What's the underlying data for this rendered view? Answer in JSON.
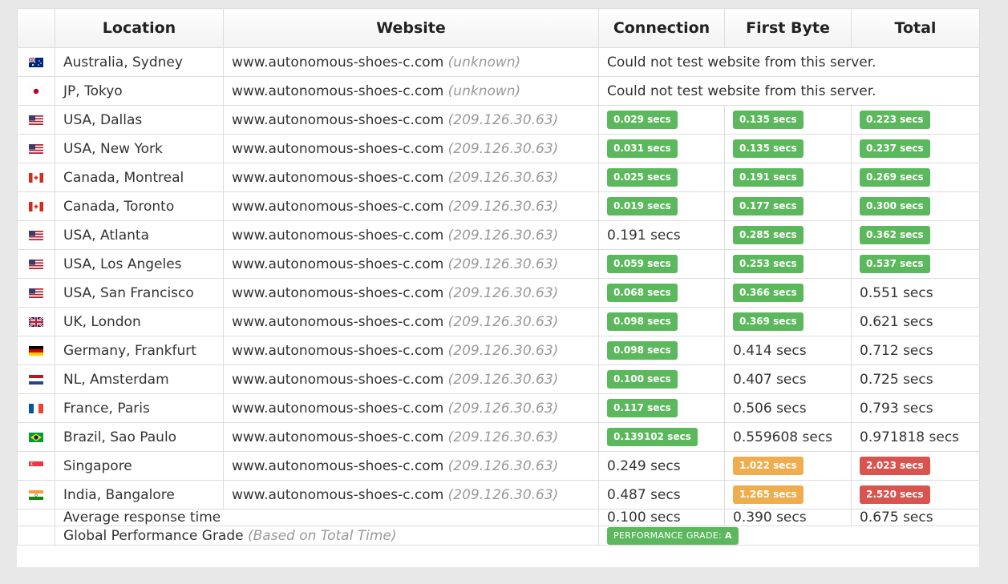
{
  "headers": {
    "flag": "",
    "location": "Location",
    "website": "Website",
    "connection": "Connection",
    "first_byte": "First Byte",
    "total": "Total"
  },
  "rows": [
    {
      "flag": "au-flag-icon",
      "location": "Australia, Sydney",
      "url": "www.autonomous-shoes-c.com",
      "ip": "(unknown)",
      "message": "Could not test website from this server."
    },
    {
      "flag": "jp-flag-icon",
      "location": "JP, Tokyo",
      "url": "www.autonomous-shoes-c.com",
      "ip": "(unknown)",
      "message": "Could not test website from this server."
    },
    {
      "flag": "us-flag-icon",
      "location": "USA, Dallas",
      "url": "www.autonomous-shoes-c.com",
      "ip": "(209.126.30.63)",
      "connection": "0.029 secs",
      "connection_status": "green",
      "first_byte": "0.135 secs",
      "first_byte_status": "green",
      "total": "0.223 secs",
      "total_status": "green"
    },
    {
      "flag": "us-flag-icon",
      "location": "USA, New York",
      "url": "www.autonomous-shoes-c.com",
      "ip": "(209.126.30.63)",
      "connection": "0.031 secs",
      "connection_status": "green",
      "first_byte": "0.135 secs",
      "first_byte_status": "green",
      "total": "0.237 secs",
      "total_status": "green"
    },
    {
      "flag": "ca-flag-icon",
      "location": "Canada, Montreal",
      "url": "www.autonomous-shoes-c.com",
      "ip": "(209.126.30.63)",
      "connection": "0.025 secs",
      "connection_status": "green",
      "first_byte": "0.191 secs",
      "first_byte_status": "green",
      "total": "0.269 secs",
      "total_status": "green"
    },
    {
      "flag": "ca-flag-icon",
      "location": "Canada, Toronto",
      "url": "www.autonomous-shoes-c.com",
      "ip": "(209.126.30.63)",
      "connection": "0.019 secs",
      "connection_status": "green",
      "first_byte": "0.177 secs",
      "first_byte_status": "green",
      "total": "0.300 secs",
      "total_status": "green"
    },
    {
      "flag": "us-flag-icon",
      "location": "USA, Atlanta",
      "url": "www.autonomous-shoes-c.com",
      "ip": "(209.126.30.63)",
      "connection": "0.191 secs",
      "connection_status": "plain",
      "first_byte": "0.285 secs",
      "first_byte_status": "green",
      "total": "0.362 secs",
      "total_status": "green"
    },
    {
      "flag": "us-flag-icon",
      "location": "USA, Los Angeles",
      "url": "www.autonomous-shoes-c.com",
      "ip": "(209.126.30.63)",
      "connection": "0.059 secs",
      "connection_status": "green",
      "first_byte": "0.253 secs",
      "first_byte_status": "green",
      "total": "0.537 secs",
      "total_status": "green"
    },
    {
      "flag": "us-flag-icon",
      "location": "USA, San Francisco",
      "url": "www.autonomous-shoes-c.com",
      "ip": "(209.126.30.63)",
      "connection": "0.068 secs",
      "connection_status": "green",
      "first_byte": "0.366 secs",
      "first_byte_status": "green",
      "total": "0.551 secs",
      "total_status": "plain"
    },
    {
      "flag": "uk-flag-icon",
      "location": "UK, London",
      "url": "www.autonomous-shoes-c.com",
      "ip": "(209.126.30.63)",
      "connection": "0.098 secs",
      "connection_status": "green",
      "first_byte": "0.369 secs",
      "first_byte_status": "green",
      "total": "0.621 secs",
      "total_status": "plain"
    },
    {
      "flag": "de-flag-icon",
      "location": "Germany, Frankfurt",
      "url": "www.autonomous-shoes-c.com",
      "ip": "(209.126.30.63)",
      "connection": "0.098 secs",
      "connection_status": "green",
      "first_byte": "0.414 secs",
      "first_byte_status": "plain",
      "total": "0.712 secs",
      "total_status": "plain"
    },
    {
      "flag": "nl-flag-icon",
      "location": "NL, Amsterdam",
      "url": "www.autonomous-shoes-c.com",
      "ip": "(209.126.30.63)",
      "connection": "0.100 secs",
      "connection_status": "green",
      "first_byte": "0.407 secs",
      "first_byte_status": "plain",
      "total": "0.725 secs",
      "total_status": "plain"
    },
    {
      "flag": "fr-flag-icon",
      "location": "France, Paris",
      "url": "www.autonomous-shoes-c.com",
      "ip": "(209.126.30.63)",
      "connection": "0.117 secs",
      "connection_status": "green",
      "first_byte": "0.506 secs",
      "first_byte_status": "plain",
      "total": "0.793 secs",
      "total_status": "plain"
    },
    {
      "flag": "br-flag-icon",
      "location": "Brazil, Sao Paulo",
      "url": "www.autonomous-shoes-c.com",
      "ip": "(209.126.30.63)",
      "connection": "0.139102 secs",
      "connection_status": "green",
      "first_byte": "0.559608 secs",
      "first_byte_status": "plain",
      "total": "0.971818 secs",
      "total_status": "plain"
    },
    {
      "flag": "sg-flag-icon",
      "location": "Singapore",
      "url": "www.autonomous-shoes-c.com",
      "ip": "(209.126.30.63)",
      "connection": "0.249 secs",
      "connection_status": "plain",
      "first_byte": "1.022 secs",
      "first_byte_status": "orange",
      "total": "2.023 secs",
      "total_status": "red"
    },
    {
      "flag": "in-flag-icon",
      "location": "India, Bangalore",
      "url": "www.autonomous-shoes-c.com",
      "ip": "(209.126.30.63)",
      "connection": "0.487 secs",
      "connection_status": "plain",
      "first_byte": "1.265 secs",
      "first_byte_status": "orange",
      "total": "2.520 secs",
      "total_status": "red"
    }
  ],
  "average": {
    "label": "Average response time",
    "connection": "0.100 secs",
    "first_byte": "0.390 secs",
    "total": "0.675 secs"
  },
  "grade": {
    "label": "Global Performance Grade",
    "note": "(Based on Total Time)",
    "badge_label": "PERFORMANCE GRADE:",
    "badge_value": "A"
  },
  "colors": {
    "green": "#5cb85c",
    "orange": "#f0ad4e",
    "red": "#d9534f",
    "page_background": "#e8e8e8"
  }
}
